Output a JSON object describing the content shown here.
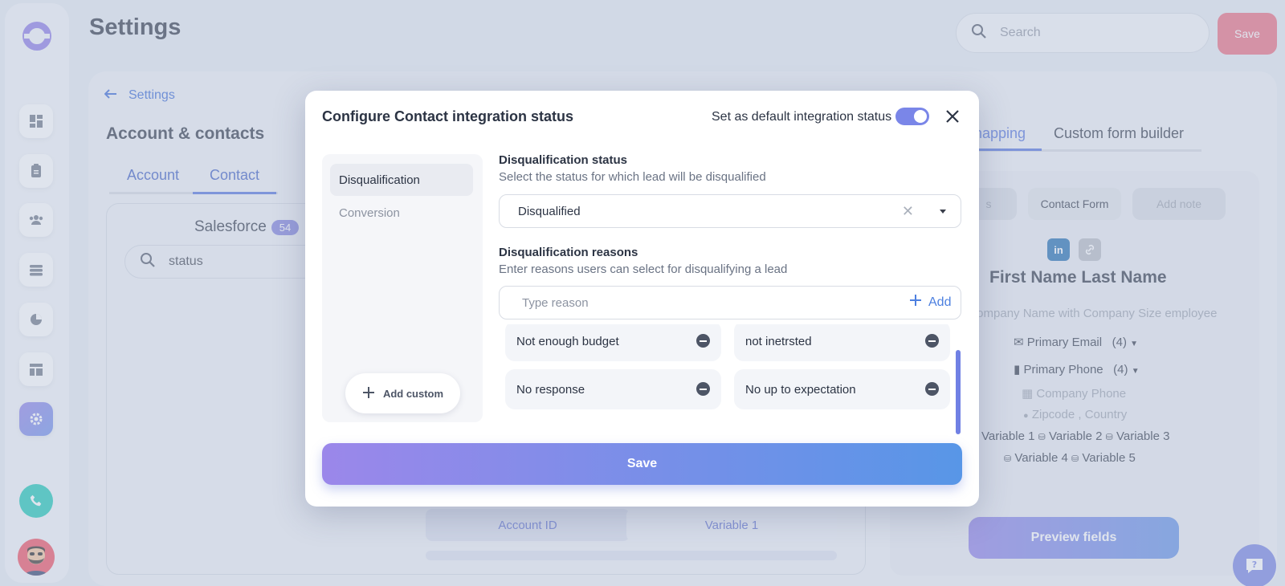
{
  "header": {
    "title": "Settings",
    "search_placeholder": "Search",
    "save_label": "Save"
  },
  "breadcrumb": {
    "back_label": "Settings"
  },
  "section": {
    "title": "Account & contacts",
    "tabs": [
      "Account",
      "Contact"
    ],
    "active_tab": "Contact"
  },
  "salesforce": {
    "title": "Salesforce",
    "count": "54",
    "search_value": "status",
    "mapping_rows": [
      {
        "left": "Account ID",
        "right": "Variable 1"
      }
    ]
  },
  "right_panel": {
    "tabs": [
      "napping",
      "Custom form builder"
    ],
    "chips": [
      "s",
      "Contact Form",
      "Add note"
    ],
    "full_name": "First Name Last Name",
    "company_line": "t Company Name with Company Size employee",
    "primary_email": "Primary Email",
    "primary_email_count": "(4)",
    "primary_phone": "Primary Phone",
    "primary_phone_count": "(4)",
    "company_phone": "Company Phone",
    "zipcode": "Zipcode",
    "country": "Country",
    "variables_row1": [
      "Variable 1",
      "Variable 2",
      "Variable 3"
    ],
    "variables_row2": [
      "Variable 4",
      "Variable 5"
    ],
    "preview_label": "Preview fields"
  },
  "modal": {
    "title": "Configure Contact integration status",
    "default_label": "Set as default integration status",
    "default_enabled": true,
    "side_items": [
      "Disqualification",
      "Conversion"
    ],
    "active_side_item": "Disqualification",
    "add_custom_label": "Add custom",
    "status_label": "Disqualification status",
    "status_help": "Select the status for which lead will be disqualified",
    "status_value": "Disqualified",
    "reasons_label": "Disqualification reasons",
    "reasons_help": "Enter reasons users can select for disqualifying a lead",
    "reason_placeholder": "Type reason",
    "add_label": "Add",
    "reasons": [
      "Not enough budget",
      "not inetrsted",
      "No response",
      "No up to expectation"
    ],
    "save_label": "Save"
  },
  "colors": {
    "accent": "#6b8de9",
    "danger": "#ec6a7e",
    "call": "#16c7b4"
  }
}
